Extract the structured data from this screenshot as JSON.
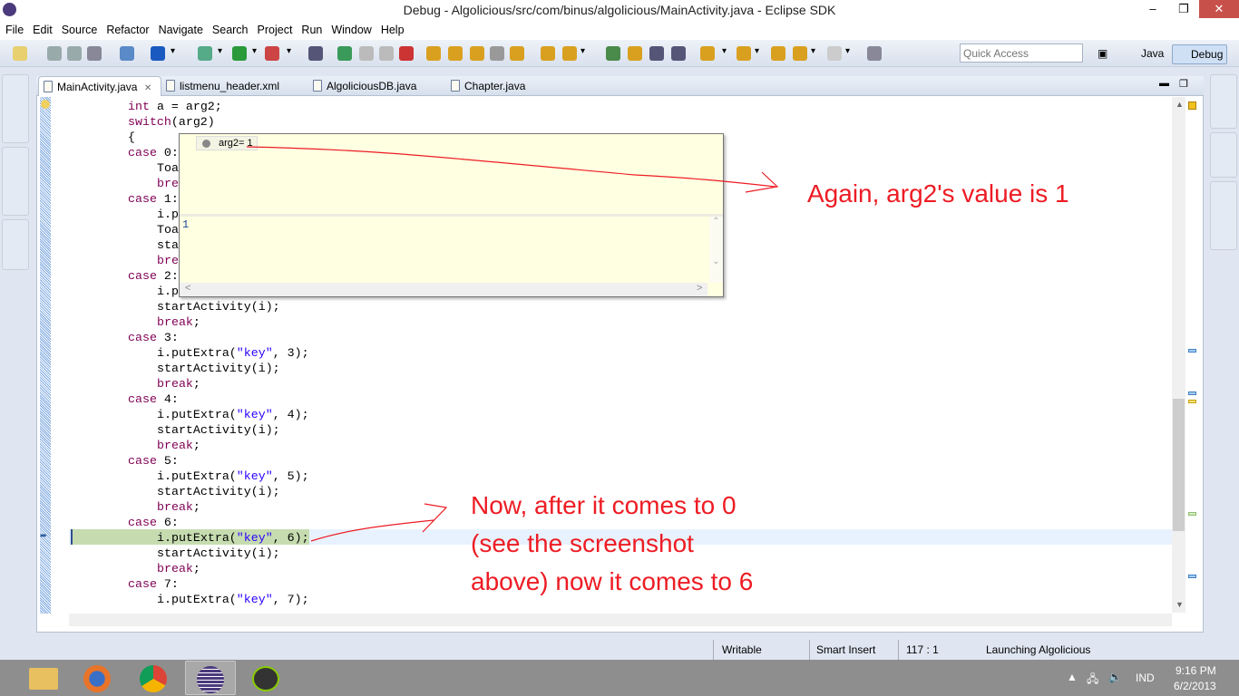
{
  "window": {
    "title": "Debug - Algolicious/src/com/binus/algolicious/MainActivity.java - Eclipse SDK",
    "minimize": "–",
    "maximize": "❐",
    "close": "✕"
  },
  "menu": [
    "File",
    "Edit",
    "Source",
    "Refactor",
    "Navigate",
    "Search",
    "Project",
    "Run",
    "Window",
    "Help"
  ],
  "quick_access": {
    "placeholder": "Quick Access"
  },
  "perspectives": [
    {
      "label": "Java",
      "active": false
    },
    {
      "label": "Debug",
      "active": true
    }
  ],
  "tabs": [
    {
      "label": "MainActivity.java",
      "active": true,
      "close": "✕"
    },
    {
      "label": "listmenu_header.xml"
    },
    {
      "label": "AlgoliciousDB.java"
    },
    {
      "label": "Chapter.java"
    }
  ],
  "code_lines": [
    {
      "indent": 0,
      "parts": [
        [
          "kw",
          "int"
        ],
        [
          "",
          "a = arg2;"
        ]
      ]
    },
    {
      "indent": 0,
      "parts": [
        [
          "kw",
          "switch"
        ],
        [
          "",
          "(arg2)"
        ]
      ]
    },
    {
      "indent": 0,
      "parts": [
        [
          "",
          "{"
        ]
      ]
    },
    {
      "indent": 0,
      "parts": [
        [
          "kw",
          "case"
        ],
        [
          "",
          " 0:"
        ]
      ]
    },
    {
      "indent": 1,
      "parts": [
        [
          "",
          "Toa"
        ]
      ]
    },
    {
      "indent": 1,
      "parts": [
        [
          "kw",
          "bre"
        ]
      ]
    },
    {
      "indent": 0,
      "parts": [
        [
          "kw",
          "case"
        ],
        [
          "",
          " 1:"
        ]
      ]
    },
    {
      "indent": 1,
      "parts": [
        [
          "",
          "i.p"
        ]
      ]
    },
    {
      "indent": 1,
      "parts": [
        [
          "",
          "Toa"
        ]
      ]
    },
    {
      "indent": 1,
      "parts": [
        [
          "",
          "sta"
        ]
      ]
    },
    {
      "indent": 1,
      "parts": [
        [
          "kw",
          "bre"
        ]
      ]
    },
    {
      "indent": 0,
      "parts": [
        [
          "kw",
          "case"
        ],
        [
          "",
          " 2:"
        ]
      ]
    },
    {
      "indent": 1,
      "parts": [
        [
          "",
          "i.p"
        ]
      ]
    },
    {
      "indent": 1,
      "parts": [
        [
          "",
          "startActivity(i);"
        ]
      ]
    },
    {
      "indent": 1,
      "parts": [
        [
          "kw",
          "break"
        ],
        [
          "",
          ";"
        ]
      ]
    },
    {
      "indent": 0,
      "parts": [
        [
          "kw",
          "case"
        ],
        [
          "",
          " 3:"
        ]
      ]
    },
    {
      "indent": 1,
      "parts": [
        [
          "",
          "i.putExtra("
        ],
        [
          "str",
          "\"key\""
        ],
        [
          "",
          ", 3);"
        ]
      ]
    },
    {
      "indent": 1,
      "parts": [
        [
          "",
          "startActivity(i);"
        ]
      ]
    },
    {
      "indent": 1,
      "parts": [
        [
          "kw",
          "break"
        ],
        [
          "",
          ";"
        ]
      ]
    },
    {
      "indent": 0,
      "parts": [
        [
          "kw",
          "case"
        ],
        [
          "",
          " 4:"
        ]
      ]
    },
    {
      "indent": 1,
      "parts": [
        [
          "",
          "i.putExtra("
        ],
        [
          "str",
          "\"key\""
        ],
        [
          "",
          ", 4);"
        ]
      ]
    },
    {
      "indent": 1,
      "parts": [
        [
          "",
          "startActivity(i);"
        ]
      ]
    },
    {
      "indent": 1,
      "parts": [
        [
          "kw",
          "break"
        ],
        [
          "",
          ";"
        ]
      ]
    },
    {
      "indent": 0,
      "parts": [
        [
          "kw",
          "case"
        ],
        [
          "",
          " 5:"
        ]
      ]
    },
    {
      "indent": 1,
      "parts": [
        [
          "",
          "i.putExtra("
        ],
        [
          "str",
          "\"key\""
        ],
        [
          "",
          ", 5);"
        ]
      ]
    },
    {
      "indent": 1,
      "parts": [
        [
          "",
          "startActivity(i);"
        ]
      ]
    },
    {
      "indent": 1,
      "parts": [
        [
          "kw",
          "break"
        ],
        [
          "",
          ";"
        ]
      ]
    },
    {
      "indent": 0,
      "parts": [
        [
          "kw",
          "case"
        ],
        [
          "",
          " 6:"
        ]
      ]
    },
    {
      "indent": 1,
      "parts": [
        [
          "",
          "i.putExtra("
        ],
        [
          "str",
          "\"key\""
        ],
        [
          "",
          ", 6);"
        ]
      ]
    },
    {
      "indent": 1,
      "parts": [
        [
          "",
          "startActivity(i);"
        ]
      ]
    },
    {
      "indent": 1,
      "parts": [
        [
          "kw",
          "break"
        ],
        [
          "",
          ";"
        ]
      ]
    },
    {
      "indent": 0,
      "parts": [
        [
          "kw",
          "case"
        ],
        [
          "",
          " 7:"
        ]
      ]
    },
    {
      "indent": 1,
      "parts": [
        [
          "",
          "i.putExtra("
        ],
        [
          "str",
          "\"key\""
        ],
        [
          "",
          ", 7);"
        ]
      ]
    }
  ],
  "debug_popup": {
    "expression": "arg2= 1",
    "value": "1"
  },
  "annotations": {
    "first": "Again, arg2's value is 1",
    "second": [
      "Now, after it comes to 0",
      "(see the screenshot",
      "above) now it comes to 6"
    ],
    "color": "#ed1c24"
  },
  "status": {
    "writable": "Writable",
    "insert_mode": "Smart Insert",
    "position": "117 : 1",
    "progress": "Launching Algolicious"
  },
  "taskbar": {
    "language": "IND",
    "time": "9:16 PM",
    "date": "6/2/2013",
    "apps": [
      "file-explorer",
      "firefox",
      "chrome",
      "eclipse",
      "android-sdk"
    ]
  }
}
